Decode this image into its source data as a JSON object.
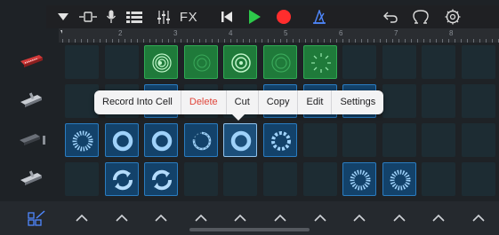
{
  "toolbar": {
    "buttons": [
      {
        "name": "browser-dropdown-icon",
        "label": ""
      },
      {
        "name": "view-toggle-icon",
        "label": ""
      },
      {
        "name": "microphone-icon",
        "label": ""
      },
      {
        "name": "tracks-view-icon",
        "label": ""
      },
      {
        "name": "mixer-icon",
        "label": ""
      },
      {
        "name": "fx-button",
        "label": "FX"
      },
      {
        "name": "go-to-beginning-icon",
        "label": ""
      },
      {
        "name": "play-icon",
        "label": ""
      },
      {
        "name": "record-icon",
        "label": ""
      },
      {
        "name": "metronome-icon",
        "label": ""
      },
      {
        "name": "undo-icon",
        "label": ""
      },
      {
        "name": "loop-browser-icon",
        "label": ""
      },
      {
        "name": "settings-icon",
        "label": ""
      }
    ],
    "fx_label": "FX",
    "colors": {
      "play": "#2dc94a",
      "record": "#ff2d2d",
      "metronome": "#4f88ff"
    }
  },
  "ruler": {
    "numbers": [
      "2",
      "3",
      "4",
      "5",
      "6",
      "7",
      "8"
    ]
  },
  "tracks": [
    {
      "instrument": "synth-keyboard-red-icon"
    },
    {
      "instrument": "keyboard-white-icon"
    },
    {
      "instrument": "keyboard-dark-icon"
    },
    {
      "instrument": "keyboard-white-icon"
    }
  ],
  "grid": {
    "rows": 4,
    "columns": 11,
    "cells": [
      {
        "row": 0,
        "col": 2,
        "style": "green",
        "glyph": "swirl"
      },
      {
        "row": 0,
        "col": 3,
        "style": "green",
        "glyph": "faint-swirl"
      },
      {
        "row": 0,
        "col": 4,
        "style": "green",
        "glyph": "rings"
      },
      {
        "row": 0,
        "col": 5,
        "style": "green",
        "glyph": "faint-rings"
      },
      {
        "row": 0,
        "col": 6,
        "style": "green",
        "glyph": "sparkle"
      },
      {
        "row": 1,
        "col": 2,
        "style": "blue",
        "glyph": "ring"
      },
      {
        "row": 1,
        "col": 5,
        "style": "blue",
        "glyph": "ring"
      },
      {
        "row": 1,
        "col": 6,
        "style": "blue",
        "glyph": "ring"
      },
      {
        "row": 1,
        "col": 7,
        "style": "blue",
        "glyph": "ring"
      },
      {
        "row": 2,
        "col": 0,
        "style": "blue",
        "glyph": "burst"
      },
      {
        "row": 2,
        "col": 1,
        "style": "blue",
        "glyph": "thick-ring"
      },
      {
        "row": 2,
        "col": 2,
        "style": "blue",
        "glyph": "thick-ring"
      },
      {
        "row": 2,
        "col": 3,
        "style": "blue",
        "glyph": "progress-ring"
      },
      {
        "row": 2,
        "col": 4,
        "style": "selected",
        "glyph": "thick-ring"
      },
      {
        "row": 2,
        "col": 5,
        "style": "blue",
        "glyph": "dash-ring"
      },
      {
        "row": 3,
        "col": 1,
        "style": "blue",
        "glyph": "cycle"
      },
      {
        "row": 3,
        "col": 2,
        "style": "blue",
        "glyph": "cycle"
      },
      {
        "row": 3,
        "col": 7,
        "style": "blue",
        "glyph": "burst"
      },
      {
        "row": 3,
        "col": 8,
        "style": "blue",
        "glyph": "burst"
      }
    ]
  },
  "context_menu": {
    "items": [
      {
        "label": "Record Into Cell",
        "destructive": false
      },
      {
        "label": "Delete",
        "destructive": true
      },
      {
        "label": "Cut",
        "destructive": false
      },
      {
        "label": "Copy",
        "destructive": false
      },
      {
        "label": "Edit",
        "destructive": false
      },
      {
        "label": "Settings",
        "destructive": false
      }
    ]
  },
  "bottom_bar": {
    "left_icon": "cell-edit-icon",
    "trigger_count": 11
  }
}
